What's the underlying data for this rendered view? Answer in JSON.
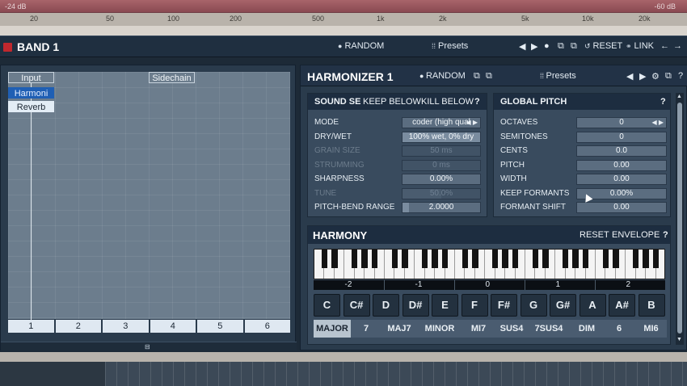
{
  "spectrum": {
    "db_left": "-24 dB",
    "db_right": "-60 dB",
    "freqs": [
      "20",
      "50",
      "100",
      "200",
      "500",
      "1k",
      "2k",
      "5k",
      "10k",
      "20k"
    ]
  },
  "band": {
    "title": "BAND 1",
    "random": "RANDOM",
    "presets": "Presets",
    "reset": "RESET",
    "link": "LINK"
  },
  "routing": {
    "input": "Input",
    "sidechain": "Sidechain",
    "nodes": [
      "Harmoni",
      "Reverb"
    ],
    "outputs": [
      "1",
      "2",
      "3",
      "4",
      "5",
      "6"
    ]
  },
  "harmonizer": {
    "title": "HARMONIZER 1",
    "random": "RANDOM",
    "presets": "Presets"
  },
  "sound": {
    "tabs": [
      "SOUND SE",
      "KEEP BELOW",
      "KILL BELOW",
      "?"
    ],
    "params": [
      {
        "label": "MODE",
        "value": "coder (high qual",
        "fill": 0,
        "enabled": true
      },
      {
        "label": "DRY/WET",
        "value": "100% wet, 0% dry",
        "fill": 1.0,
        "enabled": true
      },
      {
        "label": "GRAIN SIZE",
        "value": "50 ms",
        "fill": 0,
        "enabled": false
      },
      {
        "label": "STRUMMING",
        "value": "0 ms",
        "fill": 0,
        "enabled": false
      },
      {
        "label": "SHARPNESS",
        "value": "0.00%",
        "fill": 0,
        "enabled": true
      },
      {
        "label": "TUNE",
        "value": "50.0%",
        "fill": 0.5,
        "enabled": false
      },
      {
        "label": "PITCH-BEND RANGE",
        "value": "2.0000",
        "fill": 0.08,
        "enabled": true
      }
    ]
  },
  "global_pitch": {
    "title": "GLOBAL PITCH",
    "help": "?",
    "params": [
      {
        "label": "OCTAVES",
        "value": "0"
      },
      {
        "label": "SEMITONES",
        "value": "0"
      },
      {
        "label": "CENTS",
        "value": "0.0"
      },
      {
        "label": "PITCH",
        "value": "0.00"
      },
      {
        "label": "WIDTH",
        "value": "0.00"
      },
      {
        "label": "KEEP FORMANTS",
        "value": "0.00%"
      },
      {
        "label": "FORMANT SHIFT",
        "value": "0.00"
      }
    ]
  },
  "harmony": {
    "title": "HARMONY",
    "reset": "RESET",
    "envelope": "ENVELOPE",
    "help": "?",
    "octaves": [
      "-2",
      "-1",
      "0",
      "1",
      "2"
    ],
    "notes": [
      "C",
      "C#",
      "D",
      "D#",
      "E",
      "F",
      "F#",
      "G",
      "G#",
      "A",
      "A#",
      "B"
    ],
    "chords": [
      "MAJOR",
      "7",
      "MAJ7",
      "MINOR",
      "MI7",
      "SUS4",
      "7SUS4",
      "DIM",
      "6",
      "MI6"
    ],
    "selected_chord": "MAJOR"
  }
}
